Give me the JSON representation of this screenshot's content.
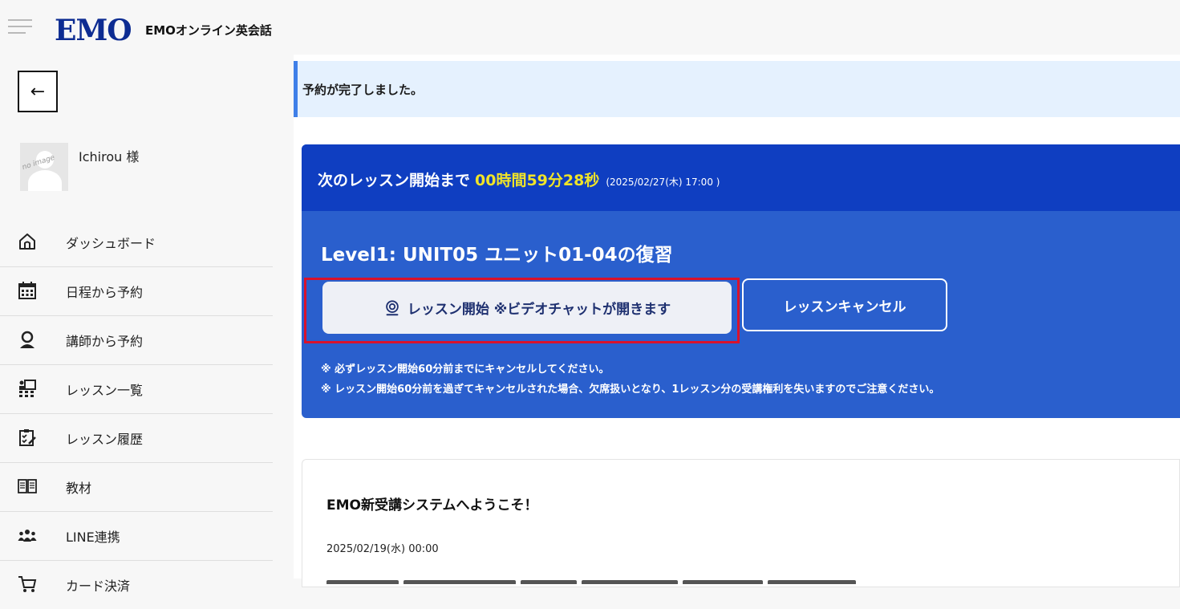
{
  "header": {
    "logo": "EMO",
    "brand_name": "EMOオンライン英会話"
  },
  "sidebar": {
    "back_label": "←",
    "avatar_text": "no image",
    "user_name": "Ichirou 様",
    "items": [
      {
        "label": "ダッシュボード",
        "icon": "home-icon"
      },
      {
        "label": "日程から予約",
        "icon": "calendar-icon"
      },
      {
        "label": "講師から予約",
        "icon": "teacher-icon"
      },
      {
        "label": "レッスン一覧",
        "icon": "lesson-list-icon"
      },
      {
        "label": "レッスン履歴",
        "icon": "clipboard-icon"
      },
      {
        "label": "教材",
        "icon": "book-icon"
      },
      {
        "label": "LINE連携",
        "icon": "group-icon"
      },
      {
        "label": "カード決済",
        "icon": "cart-icon"
      }
    ]
  },
  "main": {
    "alert": "予約が完了しました。",
    "lesson": {
      "countdown_label": "次のレッスン開始まで",
      "countdown_time": "00時間59分28秒",
      "countdown_date": "(2025/02/27(木) 17:00 )",
      "title": "Level1: UNIT05 ユニット01-04の復習",
      "start_button": "レッスン開始 ※ビデオチャットが開きます",
      "cancel_button": "レッスンキャンセル",
      "notice_1": "※ 必ずレッスン開始60分前までにキャンセルしてください。",
      "notice_2": "※ レッスン開始60分前を過ぎてキャンセルされた場合、欠席扱いとなり、1レッスン分の受講権利を失いますのでご注意ください。"
    },
    "news": {
      "title": "EMO新受講システムへようこそ！",
      "date": "2025/02/19(水) 00:00"
    }
  },
  "colors": {
    "logo": "#0d2c92",
    "card_head": "#0f3ec1",
    "card_body": "#2a5fcd",
    "countdown_highlight": "#f0e428",
    "highlight_border": "#d9122c",
    "alert_bg": "#e5f1fe"
  }
}
